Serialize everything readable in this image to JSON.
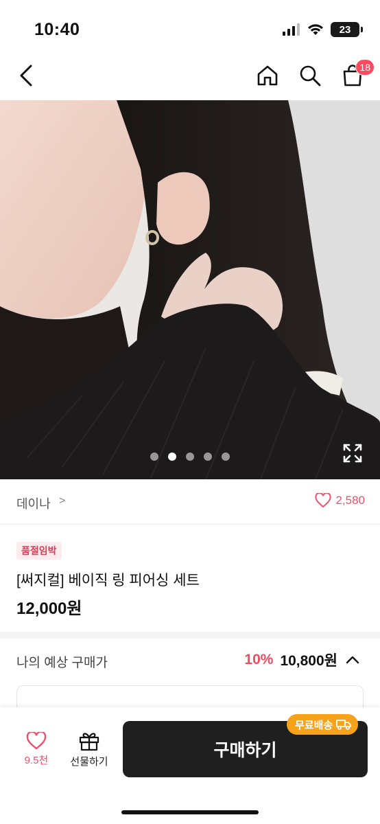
{
  "status_bar": {
    "time": "10:40",
    "battery": "23",
    "icons": [
      "signal-icon",
      "wifi-icon",
      "battery-icon"
    ]
  },
  "nav": {
    "icons": [
      "back-icon",
      "home-icon",
      "search-icon",
      "cart-icon"
    ],
    "cart_badge": "18"
  },
  "gallery": {
    "image_count": 5,
    "active_index": 1,
    "expand_icon": "expand-icon"
  },
  "brand": {
    "name": "데이나",
    "chevron": ">",
    "like_count": "2,580"
  },
  "product": {
    "badge": "품절임박",
    "title": "[써지컬] 베이직 링 피어싱 세트",
    "price": "12,000원"
  },
  "expected_price": {
    "label": "나의 예상 구매가",
    "discount": "10%",
    "price": "10,800원"
  },
  "bottom_bar": {
    "wish_count": "9.5천",
    "gift_label": "선물하기",
    "buy_label": "구매하기",
    "shipping_badge": "무료배송"
  },
  "colors": {
    "accent": "#ec4d61",
    "badge_bg": "#fdecef",
    "buy_button": "#1f1f1f",
    "shipping_badge": "#f7a21b"
  }
}
